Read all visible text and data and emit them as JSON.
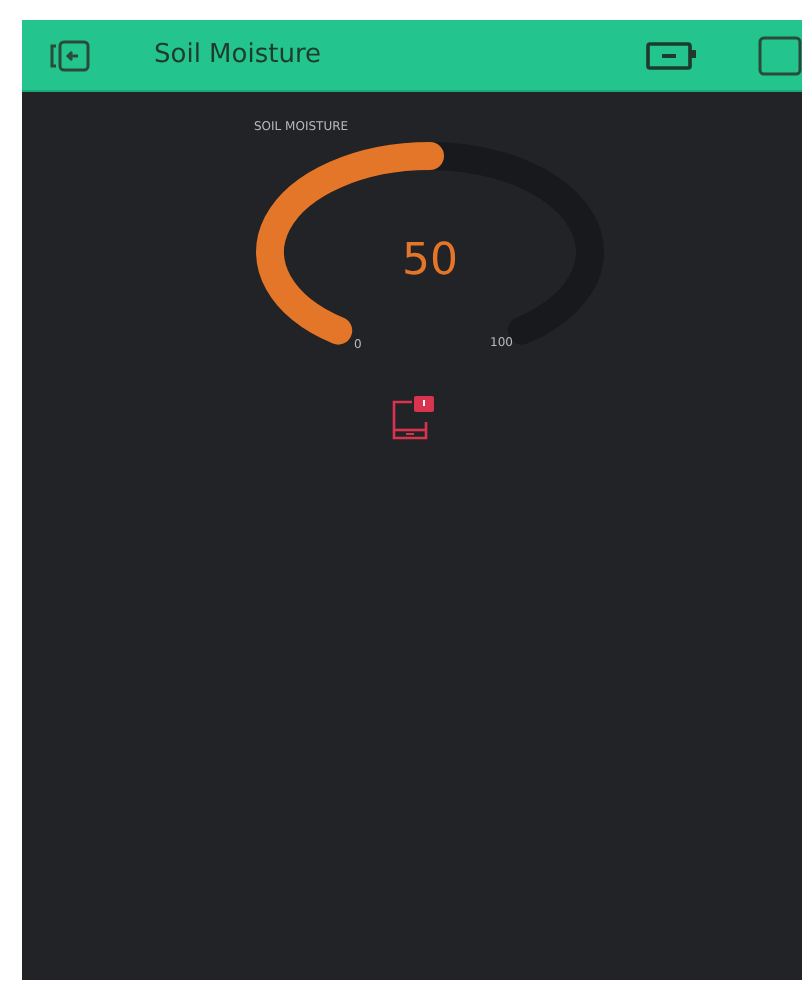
{
  "header": {
    "title": "Soil Moisture"
  },
  "gauge": {
    "label": "SOIL MOISTURE",
    "value": "50",
    "min": "0",
    "max": "100"
  }
}
